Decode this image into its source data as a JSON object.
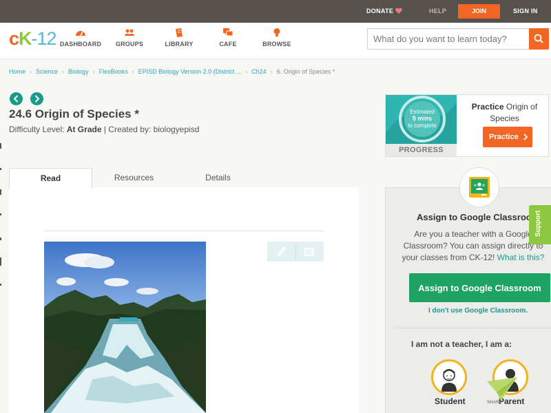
{
  "topbar": {
    "donate": "DONATE",
    "help": "HELP",
    "join": "JOIN",
    "sign_in": "SIGN IN"
  },
  "header": {
    "logo": {
      "c": "c",
      "k": "K",
      "n": "-12"
    },
    "nav": [
      {
        "label": "DASHBOARD",
        "icon": "dashboard-icon"
      },
      {
        "label": "GROUPS",
        "icon": "groups-icon"
      },
      {
        "label": "LIBRARY",
        "icon": "library-icon"
      },
      {
        "label": "CAFE",
        "icon": "cafe-icon"
      },
      {
        "label": "BROWSE",
        "icon": "browse-icon"
      }
    ],
    "search_placeholder": "What do you want to learn today?"
  },
  "breadcrumb": [
    "Home",
    "Science",
    "Biology",
    "FlexBooks",
    "EPISD Biology Version 2.0 (District ...",
    "Ch24",
    "6. Origin of Species *"
  ],
  "content": {
    "title": "24.6 Origin of Species *",
    "difficulty_label": "Difficulty Level: ",
    "difficulty_value": "At Grade",
    "created_by": " | Created by: biologyepisd",
    "tabs": [
      "Read",
      "Resources",
      "Details"
    ]
  },
  "practice": {
    "estimate_line1": "Estimated",
    "estimate_line2": "5 mins",
    "estimate_line3": "to complete",
    "progress_label": "PROGRESS",
    "title_bold": "Practice",
    "title_rest": " Origin of Species",
    "button": "Practice"
  },
  "classroom": {
    "title": "Assign to Google Classroom",
    "text": "Are you a teacher with a Google Classroom? You can assign directly to your classes from CK-12! ",
    "link": "What is this?",
    "button": "Assign to Google Classroom",
    "no_use": "I don't use Google Classroom.",
    "not_teacher": "I am not a teacher, I am a:",
    "roles": [
      "Student",
      "Parent"
    ],
    "support": "Support",
    "share": "SHARE"
  },
  "colors": {
    "accent_orange": "#f26522",
    "teal": "#1b9a8c",
    "green": "#1ea362",
    "logo_green": "#8dc63f",
    "logo_blue": "#55b6d8"
  }
}
